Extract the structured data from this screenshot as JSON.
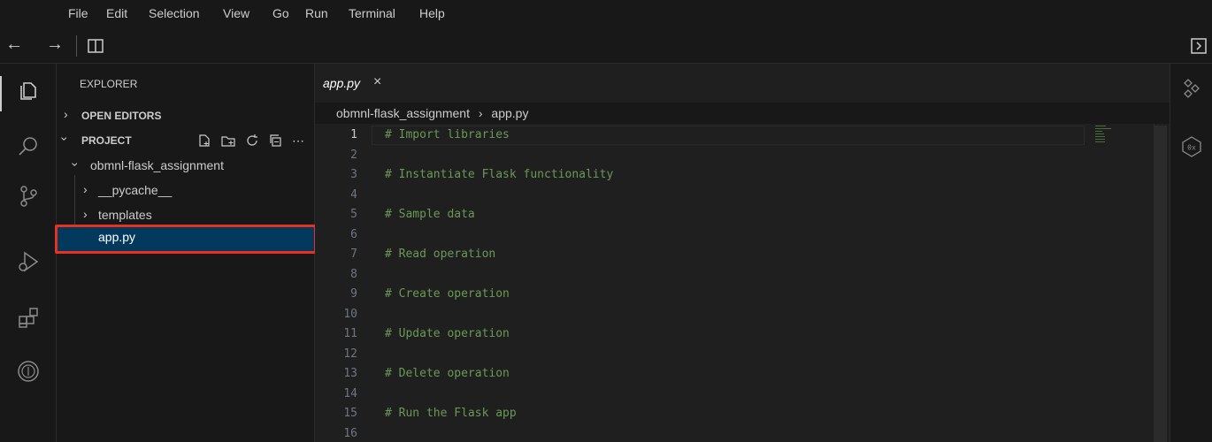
{
  "menu": [
    "File",
    "Edit",
    "Selection",
    "View",
    "Go",
    "Run",
    "Terminal",
    "Help"
  ],
  "icons": {
    "back": "arrow-left-icon",
    "forward": "arrow-right-icon",
    "layout": "layout-icon",
    "panel": "panel-toggle-icon",
    "explorer": "files-icon",
    "search": "search-icon",
    "scm": "source-control-icon",
    "debug": "run-debug-icon",
    "extensions": "extensions-icon",
    "other": "badge-icon"
  },
  "explorer": {
    "title": "EXPLORER",
    "open_editors": "OPEN EDITORS",
    "project": "PROJECT",
    "root_folder": "obmnl-flask_assignment",
    "items": [
      "__pycache__",
      "templates",
      "app.py"
    ]
  },
  "editor": {
    "tab_label": "app.py",
    "breadcrumb_folder": "obmnl-flask_assignment",
    "breadcrumb_file": "app.py",
    "lines": [
      {
        "n": "1",
        "text": "# Import libraries"
      },
      {
        "n": "2",
        "text": ""
      },
      {
        "n": "3",
        "text": "# Instantiate Flask functionality"
      },
      {
        "n": "4",
        "text": ""
      },
      {
        "n": "5",
        "text": "# Sample data"
      },
      {
        "n": "6",
        "text": ""
      },
      {
        "n": "7",
        "text": "# Read operation"
      },
      {
        "n": "8",
        "text": ""
      },
      {
        "n": "9",
        "text": "# Create operation"
      },
      {
        "n": "10",
        "text": ""
      },
      {
        "n": "11",
        "text": "# Update operation"
      },
      {
        "n": "12",
        "text": ""
      },
      {
        "n": "13",
        "text": "# Delete operation"
      },
      {
        "n": "14",
        "text": ""
      },
      {
        "n": "15",
        "text": "# Run the Flask app"
      },
      {
        "n": "16",
        "text": ""
      }
    ]
  },
  "colors": {
    "comment": "#6a9955",
    "selection": "#04395e",
    "highlight": "#e8311e"
  }
}
